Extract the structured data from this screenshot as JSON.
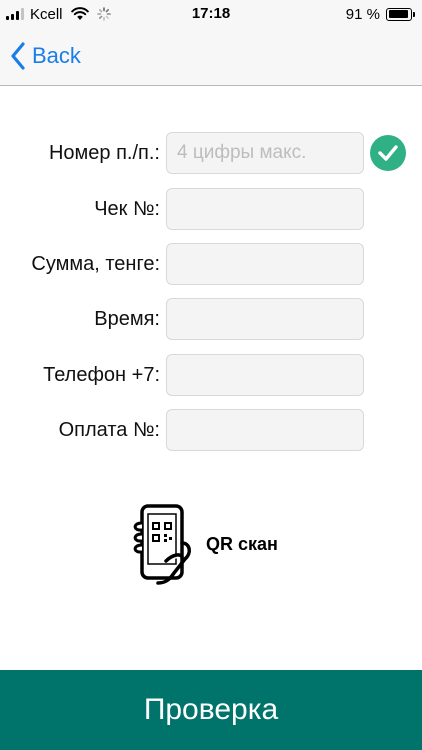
{
  "status_bar": {
    "carrier": "Kcell",
    "time": "17:18",
    "battery_percent": "91 %",
    "battery_level": 0.91,
    "signal_bars_filled": 3,
    "signal_bars_total": 4,
    "icons": [
      "signal-icon",
      "wifi-icon",
      "activity-spinner-icon",
      "battery-icon"
    ]
  },
  "nav": {
    "back_label": "Back",
    "accent_color": "#1a7ee6"
  },
  "form": {
    "fields": [
      {
        "label": "Номер п./п.:",
        "value": "",
        "placeholder": "4 цифры макс.",
        "validated": true
      },
      {
        "label": "Чек №:",
        "value": "",
        "placeholder": ""
      },
      {
        "label": "Сумма, тенге:",
        "value": "",
        "placeholder": ""
      },
      {
        "label": "Время:",
        "value": "",
        "placeholder": ""
      },
      {
        "label": "Телефон +7:",
        "value": "",
        "placeholder": ""
      },
      {
        "label": "Оплата №:",
        "value": "",
        "placeholder": ""
      }
    ],
    "check_color": "#2fb085"
  },
  "qr": {
    "label": "QR скан",
    "icon": "phone-qr-scan-icon"
  },
  "submit": {
    "label": "Проверка",
    "color": "#00736b"
  }
}
